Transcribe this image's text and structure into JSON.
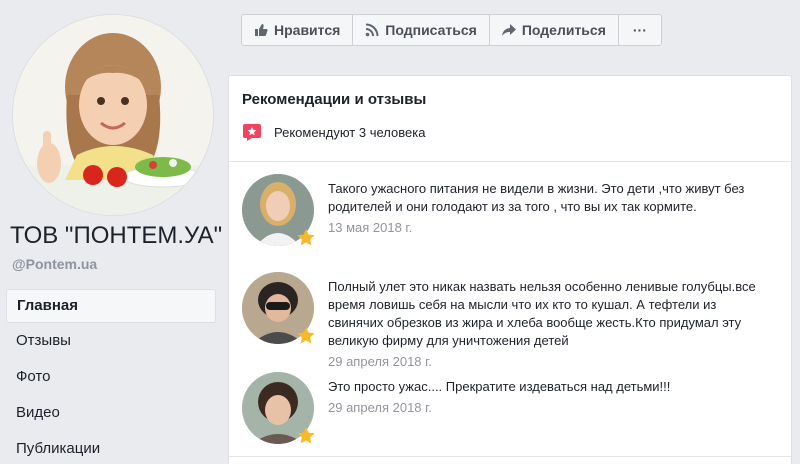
{
  "page": {
    "name": "ТОВ \"ПОНТЕМ.УА\"",
    "handle": "@Pontem.ua"
  },
  "nav": {
    "items": [
      {
        "label": "Главная",
        "active": true
      },
      {
        "label": "Отзывы"
      },
      {
        "label": "Фото"
      },
      {
        "label": "Видео"
      },
      {
        "label": "Публикации"
      }
    ]
  },
  "actions": {
    "like": "Нравится",
    "follow": "Подписаться",
    "share": "Поделиться",
    "more": "···"
  },
  "reviews_section": {
    "title": "Рекомендации и отзывы",
    "recommend_text": "Рекомендуют 3 человека",
    "items": [
      {
        "text": "Такого ужасного питания не видели в жизни. Это дети ,что живут без родителей и они голодают из за того , что вы их так кормите.",
        "date": "13 мая 2018 г."
      },
      {
        "text": "Полный улет это никак назвать нельзя особенно ленивые голубцы.все время ловишь себя на мысли что их кто то кушал. А тефтели из свинячих обрезков из жира и хлеба вообще жесть.Кто придумал эту великую фирму для уничтожения детей",
        "date": "29 апреля 2018 г."
      },
      {
        "text": "Это просто ужас.... Прекратите издеваться над детьми!!!",
        "date": "29 апреля 2018 г."
      }
    ]
  },
  "colors": {
    "background": "#e9ebee",
    "recommend_red": "#f3425f",
    "star_gold": "#f7b928",
    "muted": "#90949c"
  }
}
